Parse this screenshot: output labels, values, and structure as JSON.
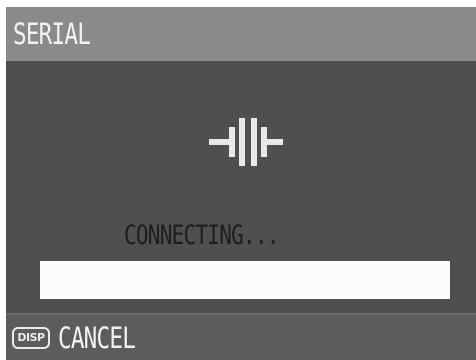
{
  "header": {
    "title": "SERIAL"
  },
  "main": {
    "icon": "serial-connector-icon",
    "status_text": "CONNECTING...",
    "progress_fraction": 1.0
  },
  "footer": {
    "button_key": "DISP",
    "cancel_label": "CANCEL"
  },
  "colors": {
    "title_bar_bg": "#8a8a8a",
    "screen_bg": "#4f4f4f",
    "progress_bar": "#f4f4f4",
    "text_light": "#f2f2f2",
    "text_dark": "#1e1e1e"
  }
}
